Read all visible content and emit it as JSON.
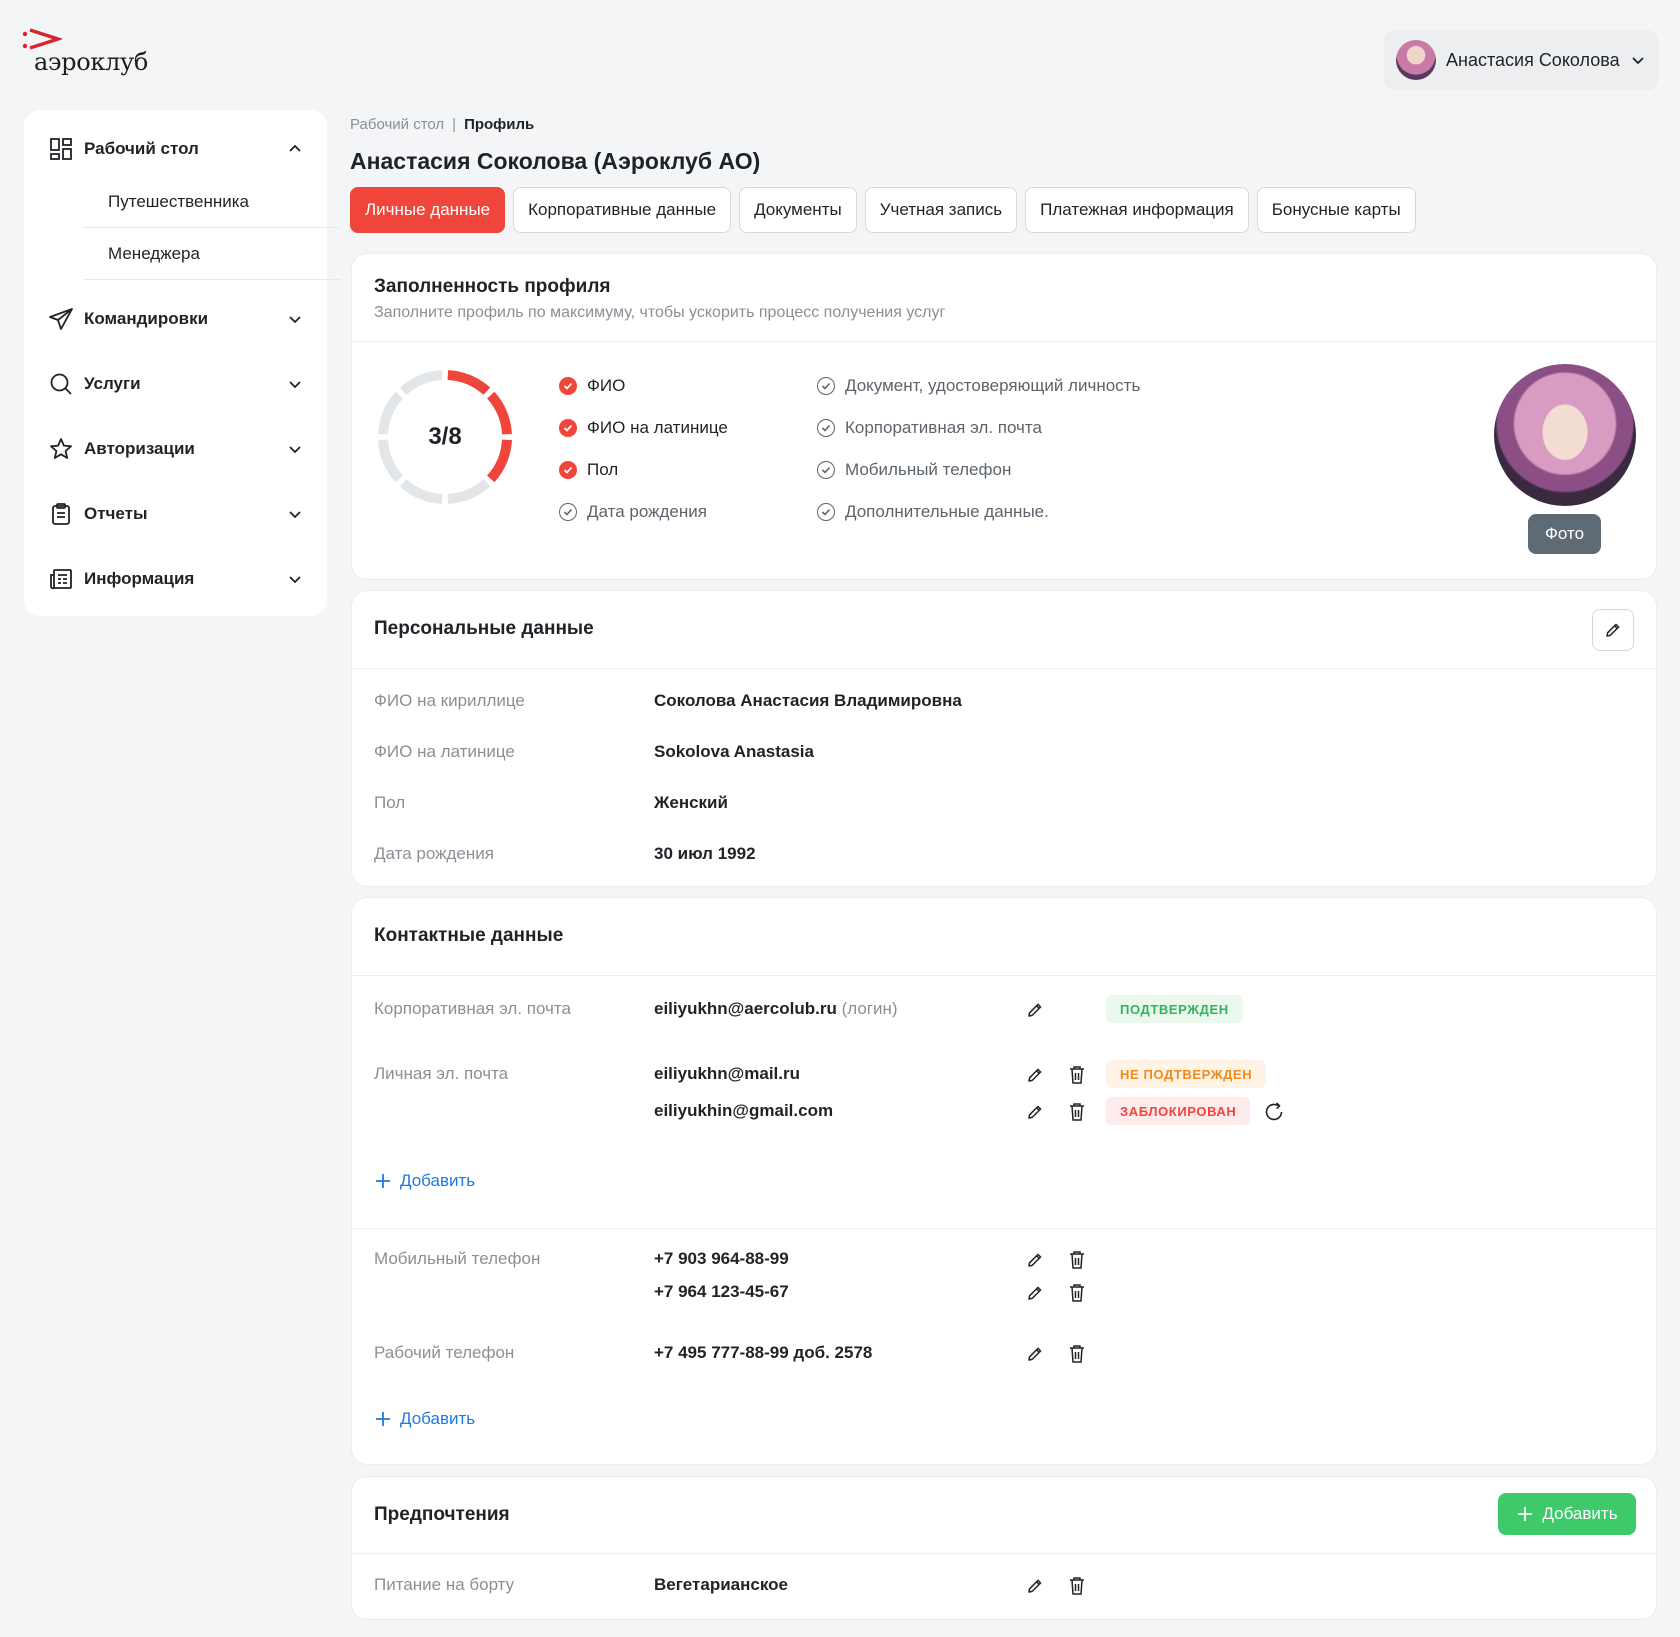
{
  "brand": {
    "name": "аэроклуб",
    "accent": "#f0453a"
  },
  "user": {
    "name": "Анастасия Соколова"
  },
  "sidebar": {
    "items": [
      {
        "label": "Рабочий стол",
        "icon": "dashboard-icon"
      },
      {
        "label": "Командировки",
        "icon": "paper-plane-icon"
      },
      {
        "label": "Услуги",
        "icon": "search-icon"
      },
      {
        "label": "Авторизации",
        "icon": "star-icon"
      },
      {
        "label": "Отчеты",
        "icon": "clipboard-icon"
      },
      {
        "label": "Информация",
        "icon": "newspaper-icon"
      }
    ],
    "subitems": [
      "Путешественника",
      "Менеджера"
    ]
  },
  "breadcrumb": {
    "home": "Рабочий стол",
    "sep": "|",
    "current": "Профиль"
  },
  "page": {
    "title": "Анастасия Соколова (Аэроклуб АО)"
  },
  "tabs": [
    {
      "label": "Личные данные",
      "active": true
    },
    {
      "label": "Корпоративные данные"
    },
    {
      "label": "Документы"
    },
    {
      "label": "Учетная запись"
    },
    {
      "label": "Платежная информация"
    },
    {
      "label": "Бонусные карты"
    }
  ],
  "completeness": {
    "title": "Заполненность профиля",
    "subtitle": "Заполните профиль по максимуму, чтобы ускорить процесс получения услуг",
    "progress": "3/8",
    "filled": 3,
    "total": 8,
    "left_items": [
      {
        "label": "ФИО",
        "done": true
      },
      {
        "label": "ФИО на латинице",
        "done": true
      },
      {
        "label": "Пол",
        "done": true
      },
      {
        "label": "Дата рождения",
        "done": false
      }
    ],
    "right_items": [
      {
        "label": "Документ, удостоверяющий личность",
        "done": false
      },
      {
        "label": "Корпоративная эл. почта",
        "done": false
      },
      {
        "label": "Мобильный телефон",
        "done": false
      },
      {
        "label": "Дополнительные данные.",
        "done": false
      }
    ],
    "photo_button": "Фото"
  },
  "personal": {
    "title": "Персональные данные",
    "rows": [
      {
        "label": "ФИО на кириллице",
        "value": "Соколова Анастасия Владимировна"
      },
      {
        "label": "ФИО на латинице",
        "value": "Sokolova Anastasia"
      },
      {
        "label": "Пол",
        "value": "Женский"
      },
      {
        "label": "Дата рождения",
        "value": "30 июл 1992"
      }
    ]
  },
  "contacts": {
    "title": "Контактные данные",
    "corp_email": {
      "label": "Корпоративная эл. почта",
      "value": "eiliyukhn@aercolub.ru",
      "note": "(логин)",
      "status": "ПОДТВЕРЖДЕН"
    },
    "personal_email": {
      "label": "Личная эл. почта",
      "values": [
        {
          "value": "eiliyukhn@mail.ru",
          "status": "НЕ ПОДТВЕРЖДЕН"
        },
        {
          "value": "eiliyukhin@gmail.com",
          "status": "ЗАБЛОКИРОВАН"
        }
      ]
    },
    "add_label": "Добавить",
    "mobile": {
      "label": "Мобильный телефон",
      "values": [
        "+7 903 964-88-99",
        "+7 964 123-45-67"
      ]
    },
    "work": {
      "label": "Рабочий телефон",
      "value": "+7 495 777-88-99 доб. 2578"
    }
  },
  "preferences": {
    "title": "Предпочтения",
    "add_label": "Добавить",
    "rows": [
      {
        "label": "Питание на борту",
        "value": "Вегетарианское"
      }
    ]
  },
  "colors": {
    "green": "#3ec96b",
    "orange": "#f08a1a",
    "red": "#f0453a",
    "link": "#1f7ae0"
  }
}
